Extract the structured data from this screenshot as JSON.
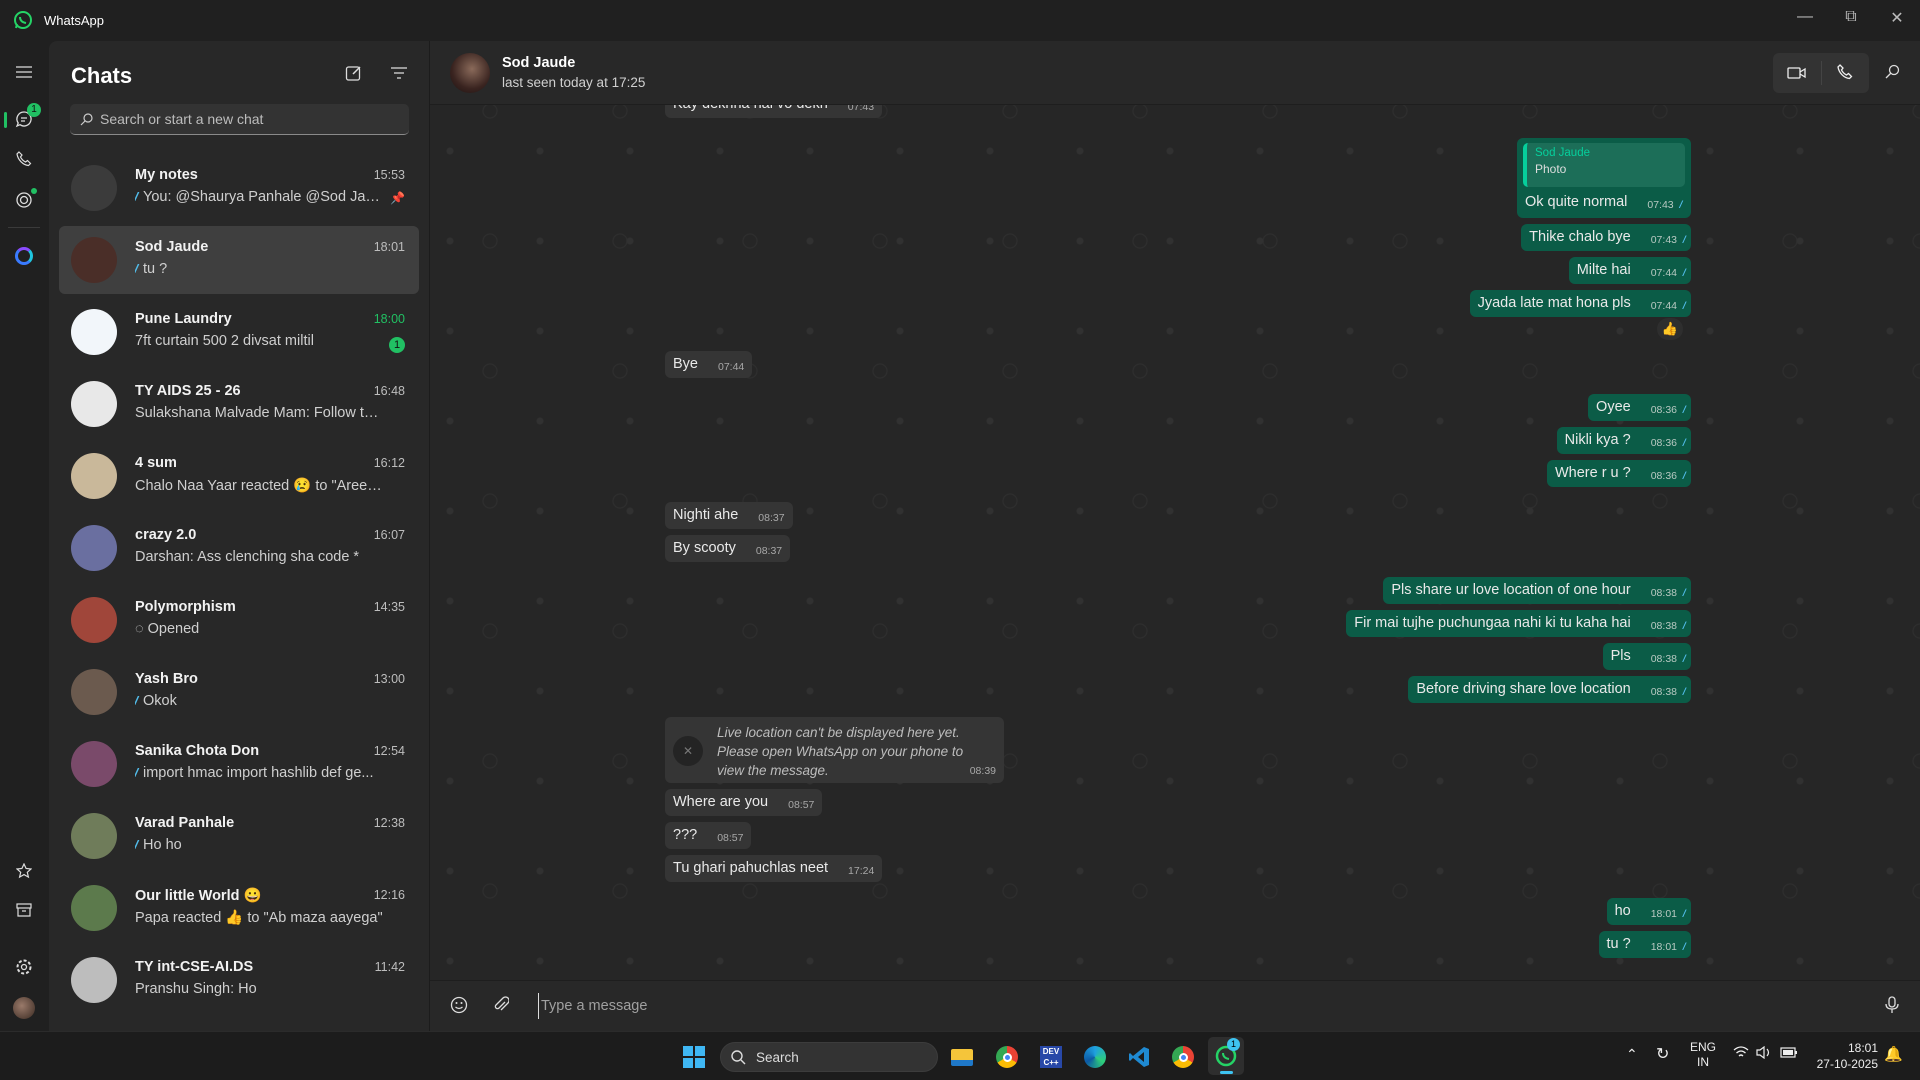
{
  "window": {
    "title": "WhatsApp"
  },
  "rail": {
    "chats_badge": "1",
    "items": [
      "menu",
      "chats",
      "calls",
      "status",
      "meta-ai",
      "starred",
      "archived",
      "settings",
      "profile"
    ]
  },
  "chats": {
    "title": "Chats",
    "search_placeholder": "Search or start a new chat",
    "items": [
      {
        "name": "My notes",
        "time": "15:53",
        "preview": "You: @Shaurya Panhale @Sod Jau...",
        "ticks": true,
        "pinned": true,
        "avatar_color": "#3b3b3b"
      },
      {
        "name": "Sod Jaude",
        "time": "18:01",
        "preview": "tu ?",
        "ticks": true,
        "selected": true,
        "avatar_color": "#4a2e28"
      },
      {
        "name": "Pune Laundry",
        "time": "18:00",
        "preview": "7ft curtain 500 2 divsat miltil",
        "unread": "1",
        "avatar_color": "#f2f6fa"
      },
      {
        "name": "TY AIDS 25 - 26",
        "time": "16:48",
        "preview": "Sulakshana Malvade Mam: Follow this li...",
        "avatar_color": "#e8e8e8"
      },
      {
        "name": "4 sum",
        "time": "16:12",
        "preview": "Chalo Naa Yaar reacted 😢 to \"Aree yaa...",
        "avatar_color": "#c9b89a"
      },
      {
        "name": "crazy 2.0",
        "time": "16:07",
        "preview": "Darshan: Ass clenching sha code *",
        "avatar_color": "#6a6fa0"
      },
      {
        "name": "Polymorphism",
        "time": "14:35",
        "preview": "◌ Opened",
        "avatar_color": "#a0463a"
      },
      {
        "name": "Yash Bro",
        "time": "13:00",
        "preview": "Okok",
        "ticks": true,
        "avatar_color": "#6b5a4e"
      },
      {
        "name": "Sanika Chota Don",
        "time": "12:54",
        "preview": "import hmac import hashlib  def ge...",
        "ticks": true,
        "avatar_color": "#7a4a6a"
      },
      {
        "name": "Varad Panhale",
        "time": "12:38",
        "preview": "Ho ho",
        "ticks": true,
        "avatar_color": "#6f7c5a"
      },
      {
        "name": "Our little World 😀",
        "time": "12:16",
        "preview": "Papa reacted 👍 to \"Ab maza aayega\"",
        "avatar_color": "#5c7a4c"
      },
      {
        "name": "TY int-CSE-AI.DS",
        "time": "11:42",
        "preview": "Pranshu Singh: Ho",
        "avatar_color": "#bdbdbd"
      }
    ]
  },
  "conversation": {
    "name": "Sod Jaude",
    "status": "last seen today at 17:25",
    "composer_placeholder": "Type a message",
    "messages": [
      {
        "dir": "in",
        "text": "Kay dekhna hai vo dekh",
        "time": "07:43"
      },
      {
        "dir": "out",
        "text": "Ok quite normal",
        "time": "07:43",
        "quote_author": "Sod Jaude",
        "quote_text": "Photo"
      },
      {
        "dir": "out",
        "text": "Thike chalo bye",
        "time": "07:43"
      },
      {
        "dir": "out",
        "text": "Milte hai",
        "time": "07:44"
      },
      {
        "dir": "out",
        "text": "Jyada late mat hona pls",
        "time": "07:44",
        "reaction": "👍"
      },
      {
        "dir": "in",
        "text": "Bye",
        "time": "07:44"
      },
      {
        "dir": "out",
        "text": "Oyee",
        "time": "08:36"
      },
      {
        "dir": "out",
        "text": "Nikli kya ?",
        "time": "08:36"
      },
      {
        "dir": "out",
        "text": "Where r u ?",
        "time": "08:36"
      },
      {
        "dir": "in",
        "text": "Nighti ahe",
        "time": "08:37"
      },
      {
        "dir": "in",
        "text": "By scooty",
        "time": "08:37"
      },
      {
        "dir": "out",
        "text": "Pls share ur love location of one hour",
        "time": "08:38"
      },
      {
        "dir": "out",
        "text": "Fir mai tujhe puchungaa nahi ki tu kaha hai",
        "time": "08:38"
      },
      {
        "dir": "out",
        "text": "Pls",
        "time": "08:38"
      },
      {
        "dir": "out",
        "text": "Before driving share love location",
        "time": "08:38"
      },
      {
        "dir": "in",
        "system": true,
        "text": "Live location can't be displayed here yet. Please open WhatsApp on your phone to view the message.",
        "time": "08:39"
      },
      {
        "dir": "in",
        "text": "Where are you",
        "time": "08:57"
      },
      {
        "dir": "in",
        "text": "???",
        "time": "08:57"
      },
      {
        "dir": "in",
        "text": "Tu ghari pahuchlas neet",
        "time": "17:24"
      },
      {
        "dir": "out",
        "text": "ho",
        "time": "18:01"
      },
      {
        "dir": "out",
        "text": "tu ?",
        "time": "18:01"
      }
    ]
  },
  "taskbar": {
    "search_label": "Search",
    "apps": [
      "file-explorer",
      "chrome",
      "dev-cpp",
      "edge",
      "vscode",
      "chrome",
      "whatsapp"
    ],
    "whatsapp_badge": "1",
    "language": "ENG",
    "region": "IN",
    "time": "18:01",
    "date": "27-10-2025"
  },
  "colors": {
    "accent": "#21c063",
    "outgoing_bubble": "#0b5c47",
    "incoming_bubble": "#353535",
    "read_tick": "#53bdeb"
  }
}
